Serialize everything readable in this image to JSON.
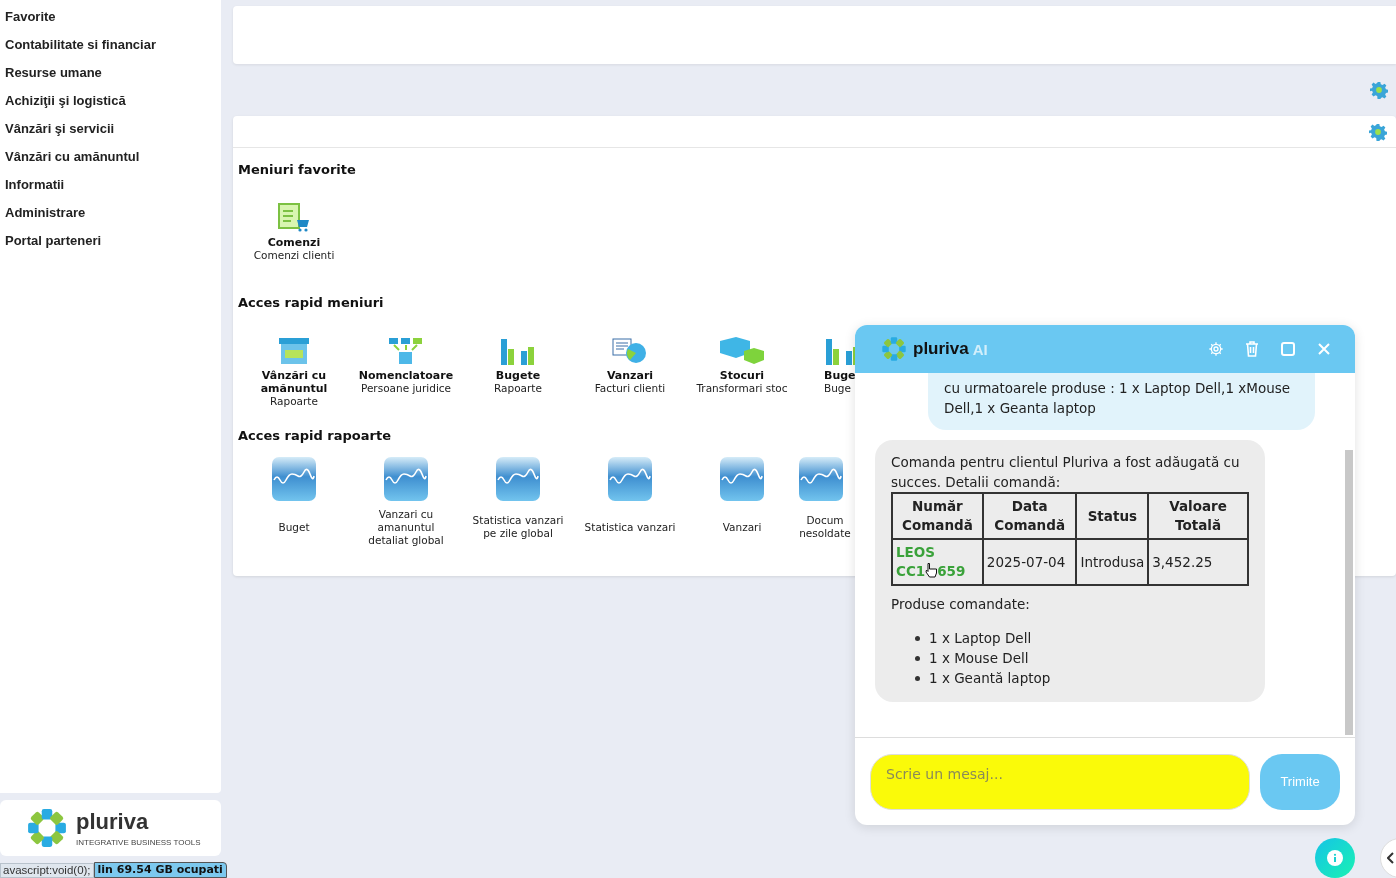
{
  "sidebar": {
    "items": [
      {
        "label": "Favorite"
      },
      {
        "label": "Contabilitate si financiar"
      },
      {
        "label": "Resurse umane"
      },
      {
        "label": "Achiziţii şi logistică"
      },
      {
        "label": "Vânzări şi servicii"
      },
      {
        "label": "Vânzări cu amănuntul"
      },
      {
        "label": "Informatii"
      },
      {
        "label": "Administrare"
      },
      {
        "label": "Portal parteneri"
      }
    ],
    "logo": {
      "name": "pluriva",
      "tagline": "INTEGRATIVE BUSINESS TOOLS"
    }
  },
  "sections": [
    {
      "title": "Meniuri favorite",
      "items": [
        {
          "kind": "orders",
          "title": "Comenzi",
          "subtitle": "Comenzi clienti"
        }
      ]
    },
    {
      "title": "Acces rapid meniuri",
      "items": [
        {
          "kind": "shop",
          "title": "Vânzări cu amănuntul",
          "subtitle": "Rapoarte"
        },
        {
          "kind": "tree",
          "title": "Nomenclatoare",
          "subtitle": "Persoane juridice"
        },
        {
          "kind": "bars",
          "title": "Bugete",
          "subtitle": "Rapoarte"
        },
        {
          "kind": "invoice",
          "title": "Vanzari",
          "subtitle": "Facturi clienti"
        },
        {
          "kind": "boxes",
          "title": "Stocuri",
          "subtitle": "Transformari stoc"
        },
        {
          "kind": "bars",
          "title": "Buge",
          "subtitle": "Buge"
        }
      ]
    },
    {
      "title": "Acces rapid rapoarte",
      "items": [
        {
          "kind": "chart",
          "subtitle": "Buget"
        },
        {
          "kind": "chart",
          "subtitle": "Vanzari cu amanuntul detaliat global"
        },
        {
          "kind": "chart",
          "subtitle": "Statistica vanzari pe zile global"
        },
        {
          "kind": "chart",
          "subtitle": "Statistica vanzari"
        },
        {
          "kind": "chart",
          "subtitle": "Vanzari"
        },
        {
          "kind": "chart",
          "subtitle": "Docum nesoldate"
        }
      ]
    }
  ],
  "chat": {
    "logo": "pluriva",
    "badge": "AI",
    "user_message": "cu urmatoarele produse : 1 x Laptop Dell,1 xMouse Dell,1 x Geanta laptop",
    "bot_message": {
      "intro": "Comanda pentru clientul Pluriva a fost adăugată cu succes. Detalii comandă:",
      "columns": [
        "Număr Comandă",
        "Data Comandă",
        "Status",
        "Valoare Totală"
      ],
      "row": {
        "order_number": "LEOS",
        "order_number_line2": "CC1",
        "order_number_tail": "659",
        "date": "2025-07-04",
        "status": "Introdusa",
        "total": "3,452.25"
      },
      "products_title": "Produse comandate:",
      "products": [
        "1 x Laptop Dell",
        "1 x Mouse Dell",
        "1 x Geantă laptop"
      ]
    },
    "input": {
      "placeholder": "Scrie un mesaj..."
    },
    "send_button": "Trimite"
  },
  "status_bar": {
    "link": "avascript:void(0);",
    "storage": "lin 69.54 GB ocupati"
  }
}
